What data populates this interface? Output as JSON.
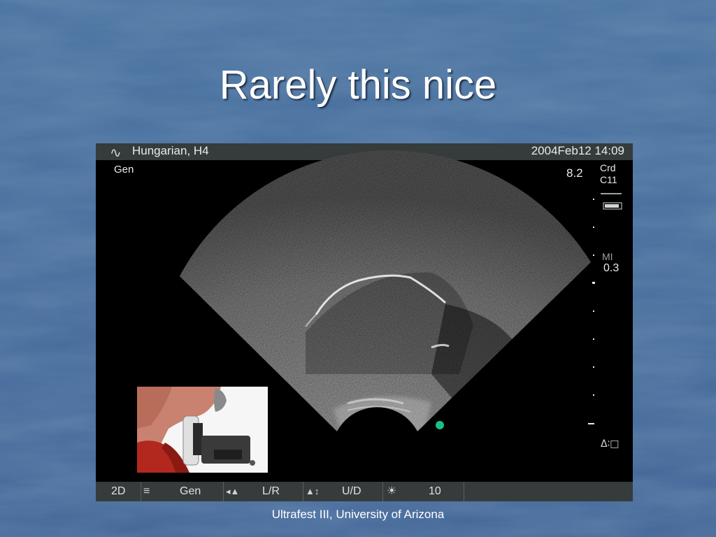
{
  "slide": {
    "title": "Rarely this nice",
    "footer": "Ultrafest III, University of Arizona"
  },
  "ultrasound": {
    "patient": "Hungarian, H4",
    "datetime": "2004Feb12 14:09",
    "mode": "Gen",
    "depth": "8.2",
    "preset_line1": "Crd",
    "preset_line2": "C11",
    "mi_label": "MI",
    "mi_value": "0.3",
    "bottom_bar": {
      "imaging_mode": "2D",
      "exam": "Gen",
      "orientation_lr": "L/R",
      "orientation_ud": "U/D",
      "brightness": "10"
    }
  },
  "colors": {
    "slide_background": "#4a6f9a",
    "title_text": "#ffffff",
    "scanner_bar": "#353c3b",
    "focus_marker": "#1bbf84"
  }
}
